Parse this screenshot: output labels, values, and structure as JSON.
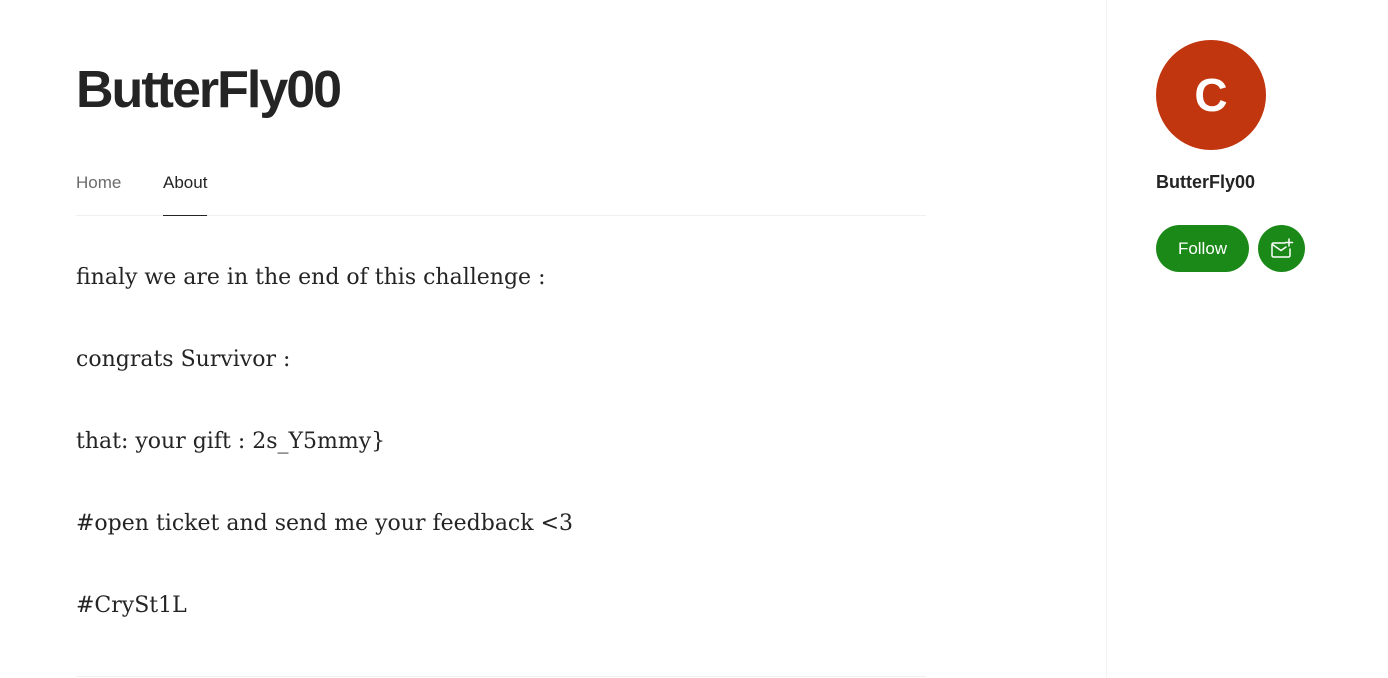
{
  "site": {
    "title": "ButterFly00"
  },
  "tabs": [
    {
      "label": "Home",
      "active": false
    },
    {
      "label": "About",
      "active": true
    }
  ],
  "content": {
    "paragraphs": [
      "finaly we are in the end of this challenge :",
      "congrats Survivor :",
      "that: your gift : 2s_Y5mmy}",
      "#open ticket and send me your feedback <3",
      "#CrySt1L"
    ]
  },
  "sidebar": {
    "avatar_letter": "C",
    "avatar_color": "#c1360f",
    "name": "ButterFly00",
    "follow_label": "Follow",
    "subscribe_icon": "mail-plus-icon",
    "accent_color": "#1a8917"
  }
}
